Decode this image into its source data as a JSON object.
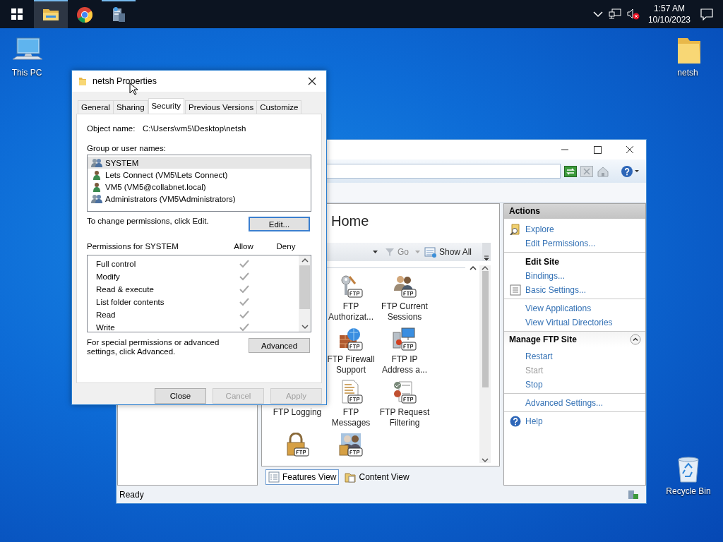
{
  "taskbar": {
    "apps": [
      {
        "kind": "explorer",
        "active": true,
        "running": true
      },
      {
        "kind": "browser",
        "active": false,
        "running": false
      },
      {
        "kind": "server",
        "active": false,
        "running": true
      }
    ],
    "clock": {
      "time": "1:57 AM",
      "date": "10/10/2023"
    }
  },
  "desktop_icons": [
    {
      "label": "This PC",
      "kind": "computer"
    },
    {
      "label": "netsh",
      "kind": "folder"
    },
    {
      "label": "Recycle Bin",
      "kind": "recycle"
    }
  ],
  "iis_window": {
    "middle": {
      "title": "Home",
      "go": "Go",
      "show_all": "Show All",
      "feature_rows": [
        {
          "features": [
            {
              "label": "FTP Authorizat...",
              "kind": "full"
            },
            {
              "label": "FTP Current Sessions",
              "kind": "full"
            }
          ]
        },
        {
          "features": [
            {
              "label": "FTP Firewall Support",
              "kind": "full"
            },
            {
              "label": "FTP IP Address a...",
              "kind": "full"
            }
          ]
        },
        {
          "features": [
            {
              "label": "FTP Logging",
              "kind": "label_only"
            },
            {
              "label": "FTP Messages",
              "kind": "full"
            },
            {
              "label": "FTP Request Filtering",
              "kind": "full"
            }
          ]
        },
        {
          "features": [
            {
              "kind": "icon_only"
            },
            {
              "kind": "icon_only"
            }
          ]
        }
      ],
      "view_tabs": [
        {
          "label": "Features View",
          "selected": true
        },
        {
          "label": "Content View",
          "selected": false
        }
      ]
    },
    "actions": {
      "title": "Actions",
      "sections": [
        {
          "groups": [
            {
              "items": [
                {
                  "label": "Explore",
                  "has_icon": true,
                  "disabled": false
                },
                {
                  "label": "Edit Permissions...",
                  "has_icon": false,
                  "disabled": false
                }
              ]
            },
            {
              "heading": "Edit Site",
              "items": [
                {
                  "label": "Bindings...",
                  "has_icon": false,
                  "disabled": false
                },
                {
                  "label": "Basic Settings...",
                  "has_icon": true,
                  "disabled": false
                }
              ]
            },
            {
              "items": [
                {
                  "label": "View Applications",
                  "has_icon": false,
                  "disabled": false
                },
                {
                  "label": "View Virtual Directories",
                  "has_icon": false,
                  "disabled": false
                }
              ]
            }
          ]
        },
        {
          "title": "Manage FTP Site",
          "expanded": true,
          "groups": [
            {
              "items": [
                {
                  "label": "Restart",
                  "has_icon": false,
                  "disabled": false
                },
                {
                  "label": "Start",
                  "has_icon": false,
                  "disabled": true
                },
                {
                  "label": "Stop",
                  "has_icon": false,
                  "disabled": false
                }
              ]
            },
            {
              "items": [
                {
                  "label": "Advanced Settings...",
                  "has_icon": false,
                  "disabled": false
                }
              ]
            },
            {
              "items": [
                {
                  "label": "Help",
                  "has_icon": true,
                  "disabled": false
                }
              ]
            }
          ]
        }
      ]
    },
    "status_bar": "Ready"
  },
  "properties_dialog": {
    "title": "netsh Properties",
    "tabs": [
      {
        "label": "General",
        "selected": false
      },
      {
        "label": "Sharing",
        "selected": false
      },
      {
        "label": "Security",
        "selected": true
      },
      {
        "label": "Previous Versions",
        "selected": false
      },
      {
        "label": "Customize",
        "selected": false
      }
    ],
    "object_name_label": "Object name:",
    "object_name": "C:\\Users\\vm5\\Desktop\\netsh",
    "users_label": "Group or user names:",
    "users": [
      {
        "name": "SYSTEM",
        "kind": "group",
        "selected": true
      },
      {
        "name": "Lets Connect (VM5\\Lets Connect)",
        "kind": "user",
        "selected": false
      },
      {
        "name": "VM5 (VM5@collabnet.local)",
        "kind": "user",
        "selected": false
      },
      {
        "name": "Administrators (VM5\\Administrators)",
        "kind": "group",
        "selected": false
      }
    ],
    "edit_hint": "To change permissions, click Edit.",
    "edit_button": {
      "label": "Edit...",
      "focused": true
    },
    "permissions_label": "Permissions for SYSTEM",
    "allow_header": "Allow",
    "deny_header": "Deny",
    "permissions": [
      {
        "name": "Full control",
        "allow": true,
        "deny": false
      },
      {
        "name": "Modify",
        "allow": true,
        "deny": false
      },
      {
        "name": "Read & execute",
        "allow": true,
        "deny": false
      },
      {
        "name": "List folder contents",
        "allow": true,
        "deny": false
      },
      {
        "name": "Read",
        "allow": true,
        "deny": false
      },
      {
        "name": "Write",
        "allow": true,
        "deny": false
      }
    ],
    "advanced_hint": "For special permissions or advanced settings, click Advanced.",
    "advanced_button": "Advanced",
    "buttons": [
      {
        "label": "Close",
        "disabled": false
      },
      {
        "label": "Cancel",
        "disabled": true
      },
      {
        "label": "Apply",
        "disabled": true
      }
    ]
  }
}
